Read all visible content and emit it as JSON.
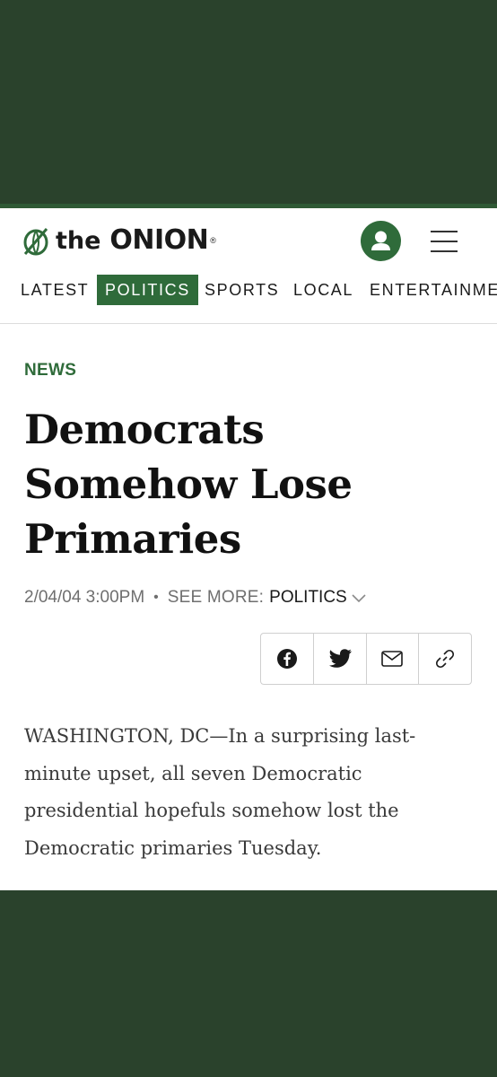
{
  "brand": {
    "logo_text": "the ONION",
    "logo_prefix": "the",
    "logo_main": "ONION",
    "registered": "®",
    "accent_color": "#2f6b3a",
    "frame_color": "#2a422c"
  },
  "header": {
    "account_icon": "user-icon",
    "menu_icon": "hamburger-menu-icon"
  },
  "nav": {
    "items": [
      {
        "label": "LATEST",
        "active": false
      },
      {
        "label": "POLITICS",
        "active": true
      },
      {
        "label": "SPORTS",
        "active": false
      },
      {
        "label": "LOCAL",
        "active": false
      },
      {
        "label": "ENTERTAINMENT",
        "active": false
      }
    ]
  },
  "article": {
    "kicker": "NEWS",
    "headline": "Democrats Somehow Lose Primaries",
    "date": "2/04/04 3:00PM",
    "see_more_label": "SEE MORE:",
    "topic": "POLITICS",
    "body": "WASHINGTON, DC—In a surprising last-minute upset, all seven Democratic presidential hopefuls somehow lost the Democratic primaries Tuesday."
  },
  "share": {
    "buttons": [
      "facebook-icon",
      "twitter-icon",
      "mail-icon",
      "link-icon"
    ]
  }
}
